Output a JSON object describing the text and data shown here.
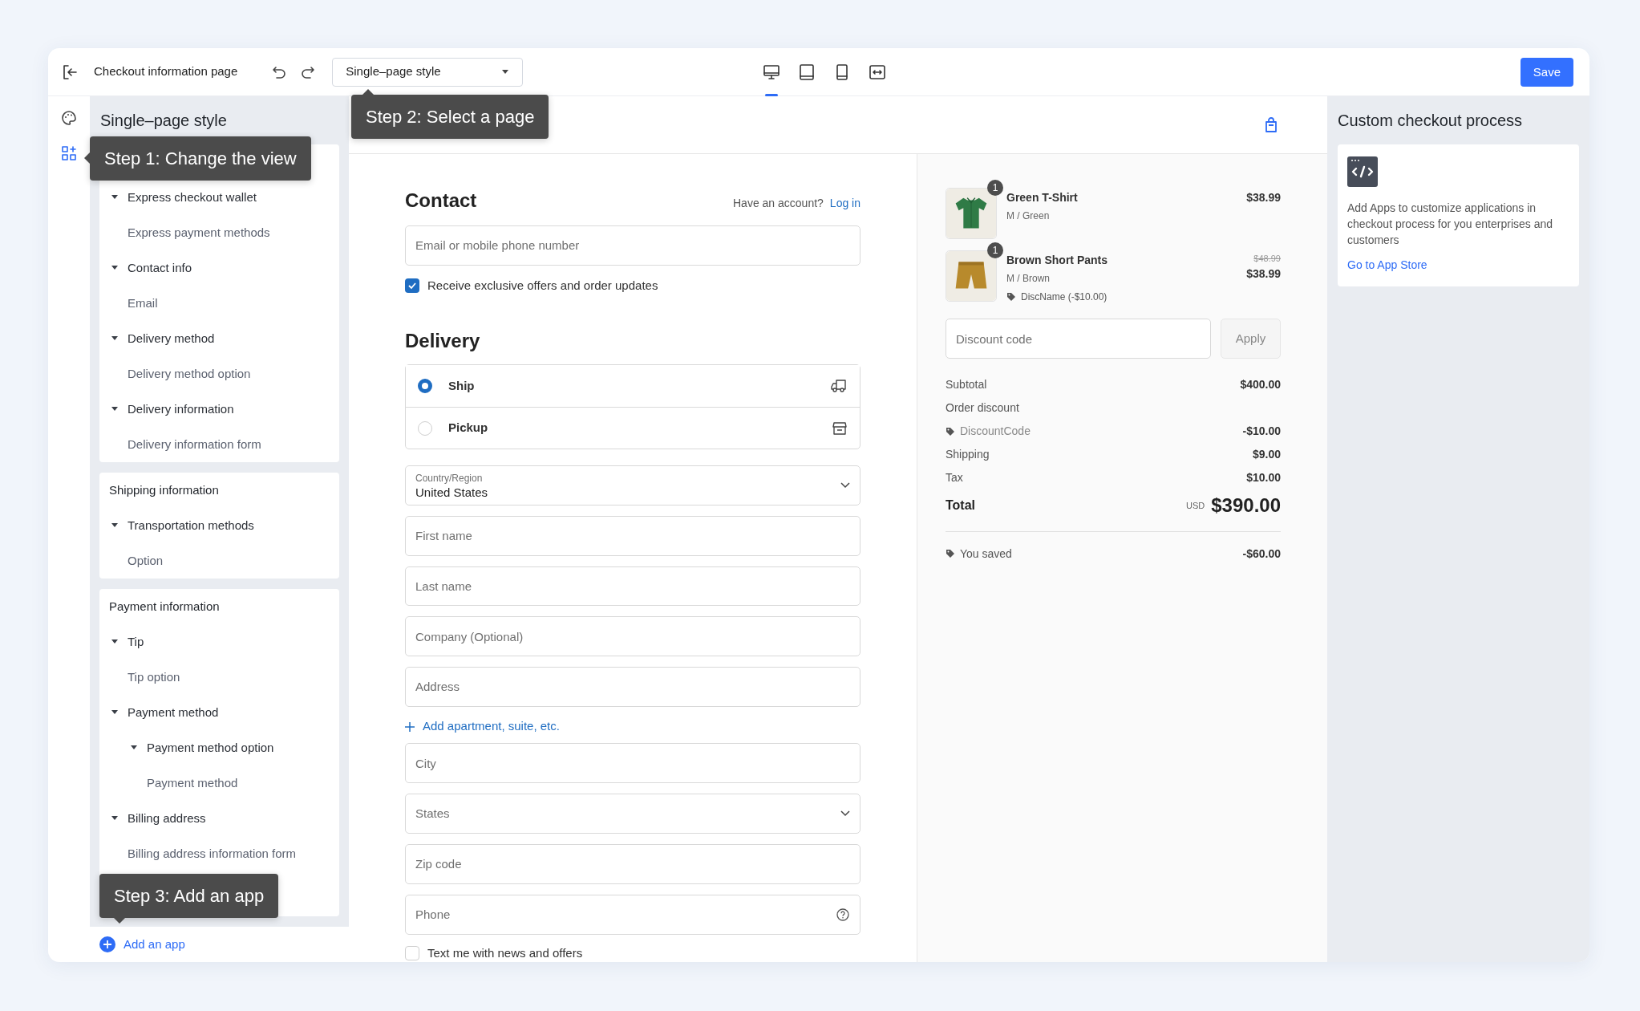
{
  "toolbar": {
    "title": "Checkout information page",
    "page_select": "Single–page style",
    "devices": [
      {
        "kind": "desktop",
        "selected": true
      },
      {
        "kind": "tablet",
        "selected": false
      },
      {
        "kind": "mobile",
        "selected": false
      },
      {
        "kind": "fullwidth",
        "selected": false
      }
    ],
    "save_button": "Save"
  },
  "sidebar": {
    "rail": [
      {
        "kind": "theme",
        "selected": false
      },
      {
        "kind": "sections",
        "selected": true
      }
    ],
    "title": "Single–page style",
    "cards": [
      {
        "items": [
          {
            "label": "Express checkout wallet",
            "expanded": true,
            "children": [
              {
                "label": "Express payment methods"
              }
            ]
          },
          {
            "label": "Contact info",
            "expanded": true,
            "children": [
              {
                "label": "Email"
              }
            ]
          },
          {
            "label": "Delivery method",
            "expanded": true,
            "children": [
              {
                "label": "Delivery method option"
              }
            ]
          },
          {
            "label": "Delivery information",
            "expanded": true,
            "children": [
              {
                "label": "Delivery information form"
              }
            ]
          }
        ]
      },
      {
        "title": "Shipping information",
        "items": [
          {
            "label": "Transportation methods",
            "expanded": true,
            "children": [
              {
                "label": "Option"
              }
            ]
          }
        ]
      },
      {
        "title": "Payment information",
        "items": [
          {
            "label": "Tip",
            "expanded": true,
            "children": [
              {
                "label": "Tip option"
              }
            ]
          },
          {
            "label": "Payment method",
            "expanded": true,
            "children": [
              {
                "label": "Payment method option",
                "expanded": true,
                "children": [
                  {
                    "label": "Payment method"
                  }
                ]
              }
            ]
          },
          {
            "label": "Billing address",
            "expanded": true,
            "children": [
              {
                "label": "Billing address information form"
              }
            ]
          }
        ]
      }
    ],
    "add_app": "Add an app"
  },
  "tooltips": [
    "Step 1: Change the view",
    "Step 2: Select a page",
    "Step 3: Add an app"
  ],
  "preview": {
    "contact": {
      "heading": "Contact",
      "account_prompt": "Have an account?",
      "login_link": "Log in",
      "email": {
        "placeholder": "Email or mobile phone number"
      },
      "offers": {
        "label": "Receive exclusive offers and order updates",
        "checked": true
      }
    },
    "delivery": {
      "heading": "Delivery",
      "options": [
        {
          "kind": "ship",
          "label": "Ship",
          "selected": true
        },
        {
          "kind": "pickup",
          "label": "Pickup",
          "selected": false
        }
      ],
      "fields": [
        {
          "kind": "select",
          "label": "Country/Region",
          "value": "United States"
        },
        {
          "kind": "text",
          "placeholder": "First name"
        },
        {
          "kind": "text",
          "placeholder": "Last name"
        },
        {
          "kind": "text",
          "placeholder": "Company (Optional)"
        },
        {
          "kind": "text",
          "placeholder": "Address"
        },
        {
          "kind": "link",
          "text": "Add apartment, suite, etc."
        },
        {
          "kind": "text",
          "placeholder": "City"
        },
        {
          "kind": "select",
          "placeholder": "States"
        },
        {
          "kind": "text",
          "placeholder": "Zip code"
        },
        {
          "kind": "help",
          "placeholder": "Phone"
        }
      ],
      "sms": {
        "label": "Text me with news and offers",
        "checked": false
      }
    },
    "summary": {
      "items": [
        {
          "kind": "shirt",
          "quantity": "1",
          "name": "Green T-Shirt",
          "variant": "M / Green",
          "price": "$38.99"
        },
        {
          "kind": "shorts",
          "quantity": "1",
          "name": "Brown Short Pants",
          "variant": "M / Brown",
          "discount": "DiscName (-$10.00)",
          "compare_price": "$48.99",
          "price": "$38.99"
        }
      ],
      "discount": {
        "placeholder": "Discount code"
      },
      "apply_button": "Apply",
      "lines": [
        {
          "kind": "plain",
          "label": "Subtotal",
          "value": "$400.00"
        },
        {
          "kind": "plain",
          "label": "Order discount"
        },
        {
          "kind": "code",
          "label": "DiscountCode",
          "value": "-$10.00"
        },
        {
          "kind": "plain",
          "label": "Shipping",
          "value": "$9.00"
        },
        {
          "kind": "plain",
          "label": "Tax",
          "value": "$10.00"
        }
      ],
      "total": {
        "label": "Total",
        "currency": "USD",
        "value": "$390.00"
      },
      "saved": {
        "label": "You saved",
        "value": "-$60.00"
      }
    }
  },
  "right_panel": {
    "title": "Custom checkout process",
    "card": {
      "text": "Add Apps to customize applications in checkout process for you enterprises and customers",
      "link": "Go to App Store"
    }
  }
}
